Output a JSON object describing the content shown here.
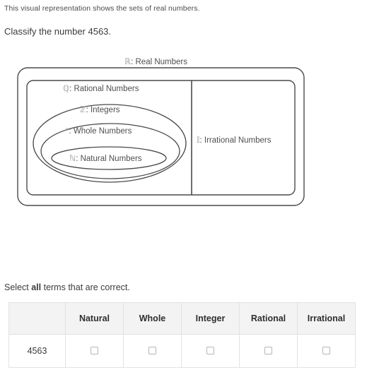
{
  "intro": {
    "description": "This visual representation shows the sets of real numbers.",
    "question": "Classify the number 4563."
  },
  "diagram": {
    "title_symbol": "ℝ",
    "title_label": ": Real Numbers",
    "sets": [
      {
        "symbol": "ℚ",
        "label": ": Rational Numbers"
      },
      {
        "symbol": "ℤ",
        "label": ": Integers"
      },
      {
        "symbol": "ᵄ",
        "label": ": Whole Numbers"
      },
      {
        "symbol": "ℕ",
        "label": ": Natural Numbers"
      },
      {
        "symbol": "𝕀",
        "label": ": Irrational Numbers"
      }
    ],
    "colors": {
      "stroke": "#4a4a4a",
      "symbol_text": "#9a9a9a",
      "label_text": "#4f4f4f"
    }
  },
  "prompt": {
    "before": "Select ",
    "bold": "all",
    "after": " terms that are correct."
  },
  "table": {
    "corner_header": "",
    "columns": [
      "Natural",
      "Whole",
      "Integer",
      "Rational",
      "Irrational"
    ],
    "rows": [
      {
        "label": "4563",
        "checkboxes": [
          false,
          false,
          false,
          false,
          false
        ]
      }
    ]
  }
}
